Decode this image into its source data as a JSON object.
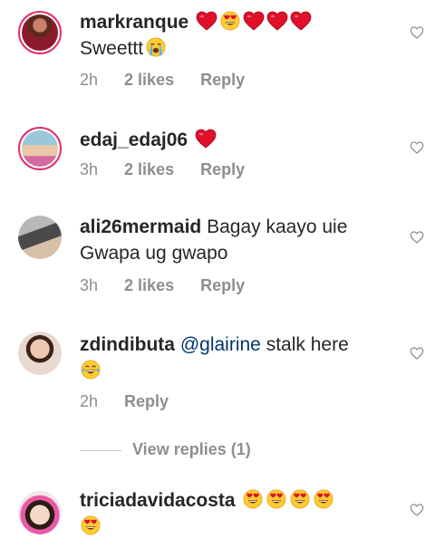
{
  "comments": [
    {
      "username": "markranque",
      "text": "",
      "text2": "Sweettt",
      "time": "2h",
      "likes": "2 likes",
      "reply": "Reply"
    },
    {
      "username": "edaj_edaj06",
      "text": "",
      "time": "3h",
      "likes": "2 likes",
      "reply": "Reply"
    },
    {
      "username": "ali26mermaid",
      "text": "Bagay kaayo uie",
      "text2": "Gwapa ug gwapo",
      "time": "3h",
      "likes": "2 likes",
      "reply": "Reply"
    },
    {
      "username": "zdindibuta",
      "mention": "@glairine",
      "text": "stalk here",
      "time": "2h",
      "reply": "Reply",
      "view_replies": "View replies (1)"
    },
    {
      "username": "triciadavidacosta",
      "text": ""
    }
  ],
  "colors": {
    "text": "#262626",
    "meta": "#8e8e8e",
    "mention": "#003569",
    "story_ring": "#e1306c",
    "heart": "#e0102a"
  },
  "icons": {
    "like": "heart-outline-icon",
    "red_heart": "red-heart-emoji",
    "heart_eyes": "heart-eyes-emoji",
    "crying": "loudly-crying-emoji",
    "tears_of_joy": "tears-of-joy-emoji"
  }
}
